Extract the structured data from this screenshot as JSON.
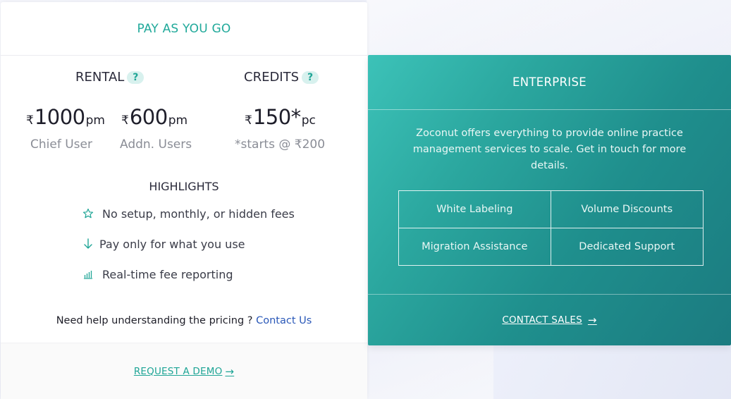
{
  "payg": {
    "title": "PAY AS YOU GO",
    "rental": {
      "label": "RENTAL",
      "help": "?",
      "chief": {
        "currency": "₹",
        "amount": "1000",
        "unit": "pm",
        "caption": "Chief User"
      },
      "addn": {
        "currency": "₹",
        "amount": "600",
        "unit": "pm",
        "caption": "Addn. Users"
      }
    },
    "credits": {
      "label": "CREDITS",
      "help": "?",
      "currency": "₹",
      "amount": "150*",
      "unit": "pc",
      "caption": "*starts @ ₹200"
    },
    "highlights": {
      "title": "HIGHLIGHTS",
      "items": [
        {
          "icon": "star-icon",
          "text": "No setup, monthly, or hidden fees"
        },
        {
          "icon": "arrow-down-icon",
          "text": "Pay only for what you use"
        },
        {
          "icon": "bar-chart-icon",
          "text": "Real-time fee reporting"
        }
      ]
    },
    "help": {
      "text": "Need help understanding the pricing ? ",
      "link": "Contact Us"
    },
    "demo": {
      "label": "REQUEST A DEMO",
      "arrow": "→"
    }
  },
  "enterprise": {
    "title": "ENTERPRISE",
    "description": "Zoconut offers everything to provide online practice management services to scale. Get in touch for more details.",
    "features": [
      "White Labeling",
      "Volume Discounts",
      "Migration Assistance",
      "Dedicated Support"
    ],
    "cta": {
      "label": "CONTACT SALES",
      "arrow": "→"
    }
  },
  "colors": {
    "accent": "#20a99a",
    "enterprise_gradient_start": "#3cc2b8",
    "enterprise_gradient_end": "#1b7b80",
    "link": "#2a58b8"
  }
}
